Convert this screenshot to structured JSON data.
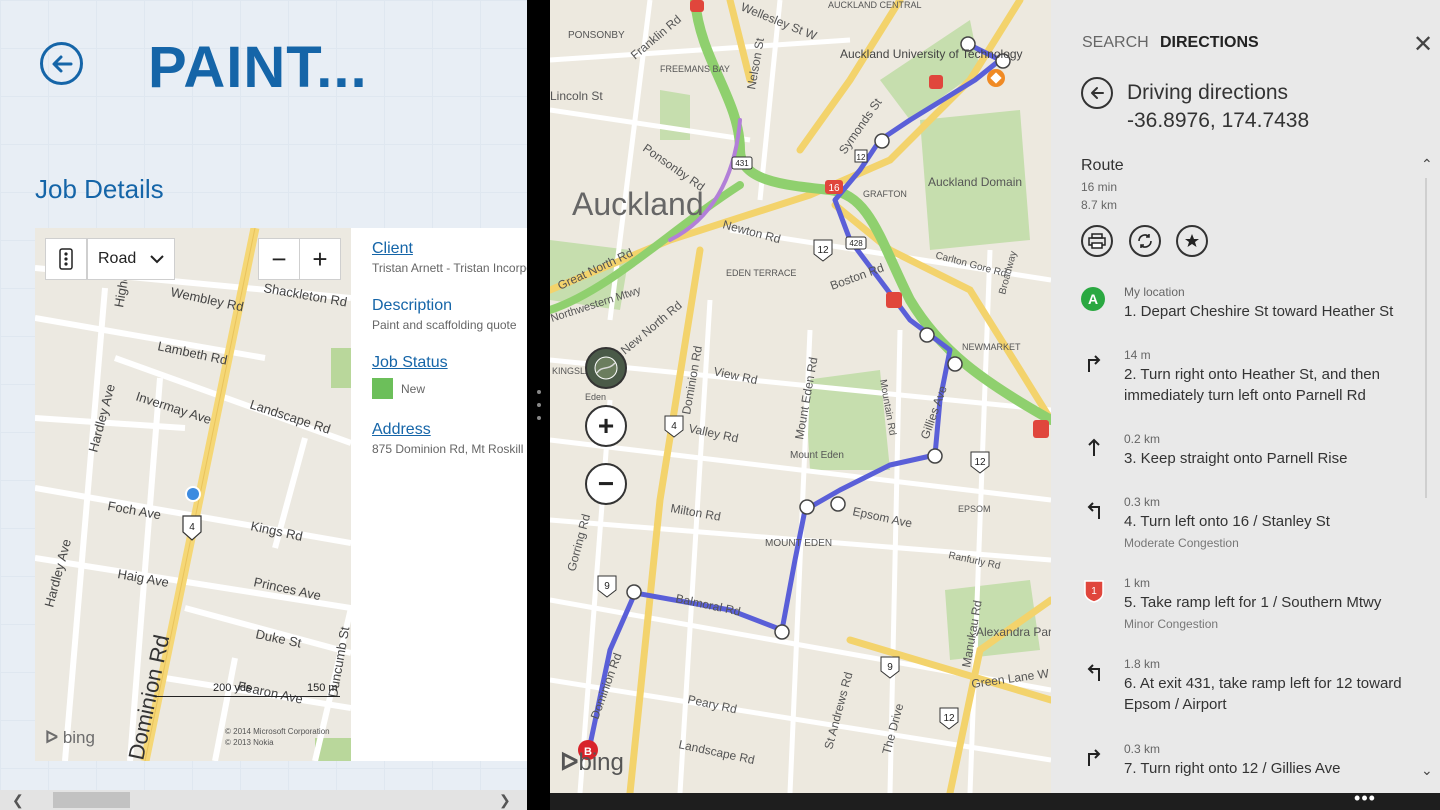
{
  "left_app": {
    "title": "PAINT...",
    "section_heading": "Job Details",
    "map": {
      "type_selected": "Road",
      "zoom_out": "−",
      "zoom_in": "+",
      "scale_yds": "200 yds",
      "scale_m": "150 m",
      "copyright_1": "© 2014 Microsoft Corporation",
      "copyright_2": "© 2013 Nokia",
      "bing": "bing",
      "labels": {
        "wembley": "Wembley Rd",
        "shackleton": "Shackleton Rd",
        "lambeth": "Lambeth Rd",
        "invermay": "Invermay Ave",
        "landscape": "Landscape Rd",
        "hardley": "Hardley Ave",
        "foch": "Foch Ave",
        "kings": "Kings Rd",
        "haig": "Haig Ave",
        "princes": "Princes Ave",
        "duke": "Duke St",
        "fearon": "Fearon Ave",
        "duncumb": "Duncumb St",
        "dominion": "Dominion Rd",
        "highcliff": "Highcliff",
        "route4": "4"
      }
    },
    "details": {
      "client_label": "Client",
      "client_value": "Tristan Arnett - Tristan Incorporated",
      "description_label": "Description",
      "description_value": "Paint and scaffolding quote",
      "status_label": "Job Status",
      "status_value": "New",
      "address_label": "Address",
      "address_value": "875 Dominion Rd, Mt Roskill"
    },
    "colors": {
      "accent": "#1565a8",
      "status_new": "#6cbf5a"
    }
  },
  "maps_app": {
    "map": {
      "city_label": "Auckland",
      "bing": "bing",
      "labels": {
        "ponsonby": "PONSONBY",
        "franklin": "Franklin Rd",
        "wellesley": "Wellesley St W",
        "auckland_central": "AUCKLAND CENTRAL",
        "aut": "Auckland University of Technology",
        "freemans_bay": "FREEMANS BAY",
        "nelson": "Nelson St",
        "lincoln": "Lincoln St",
        "ponsonby_rd": "Ponsonby Rd",
        "symonds": "Symonds St",
        "grafton": "GRAFTON",
        "auckland_domain": "Auckland Domain",
        "newton": "Newton Rd",
        "eden_terrace": "EDEN TERRACE",
        "boston": "Boston Rd",
        "carlton_gore": "Carlton Gore Rd",
        "newmarket": "NEWMARKET",
        "great_north": "Great North Rd",
        "northwestern": "Northwestern Mtwy",
        "new_north": "New North Rd",
        "kingsland": "KINGSLAND",
        "eden": "Eden",
        "view": "View Rd",
        "dominion": "Dominion Rd",
        "mountain": "Mountain Rd",
        "mount_eden_rd": "Mount Eden Rd",
        "valley": "Valley Rd",
        "mount_eden": "Mount Eden",
        "gillies": "Gillies Ave",
        "epsom_ave": "Epsom Ave",
        "epsom": "EPSOM",
        "milton": "Milton Rd",
        "mount_eden_suburb": "MOUNT EDEN",
        "ranfurly": "Ranfurly Rd",
        "balmoral": "Balmoral Rd",
        "alexandra_park": "Alexandra Park",
        "green_lane": "Green Lane W",
        "manukau": "Manukau Rd",
        "peary": "Peary Rd",
        "landscape": "Landscape Rd",
        "st_andrews": "St Andrews Rd",
        "the_drive": "The Drive",
        "gorring": "Gorring Rd",
        "broadway": "Broadway",
        "r16": "16",
        "r12": "12",
        "r9": "9",
        "r4": "4",
        "r431": "431",
        "r428": "428",
        "r1": "1"
      }
    },
    "directions": {
      "tabs": {
        "search": "SEARCH",
        "directions": "DIRECTIONS"
      },
      "title": "Driving directions",
      "destination_coords": "-36.8976, 174.7438",
      "route_label": "Route",
      "route_time": "16 min",
      "route_distance": "8.7 km",
      "steps": [
        {
          "icon": "start-a",
          "small": "My location",
          "text": "1. Depart Cheshire St toward Heather St",
          "sub": ""
        },
        {
          "icon": "turn-right",
          "small": "14 m",
          "text": "2. Turn right onto Heather St, and then immediately turn left onto Parnell Rd",
          "sub": ""
        },
        {
          "icon": "straight",
          "small": "0.2 km",
          "text": "3. Keep straight onto Parnell Rise",
          "sub": ""
        },
        {
          "icon": "turn-left",
          "small": "0.3 km",
          "text": "4. Turn left onto 16 / Stanley St",
          "sub": "Moderate Congestion"
        },
        {
          "icon": "route-shield",
          "small": "1 km",
          "text": "5. Take ramp left for 1 / Southern Mtwy",
          "sub": "Minor Congestion"
        },
        {
          "icon": "turn-left",
          "small": "1.8 km",
          "text": "6. At exit 431, take ramp left for 12 toward Epsom / Airport",
          "sub": ""
        },
        {
          "icon": "turn-right",
          "small": "0.3 km",
          "text": "7. Turn right onto 12 / Gillies Ave",
          "sub": ""
        }
      ]
    }
  }
}
